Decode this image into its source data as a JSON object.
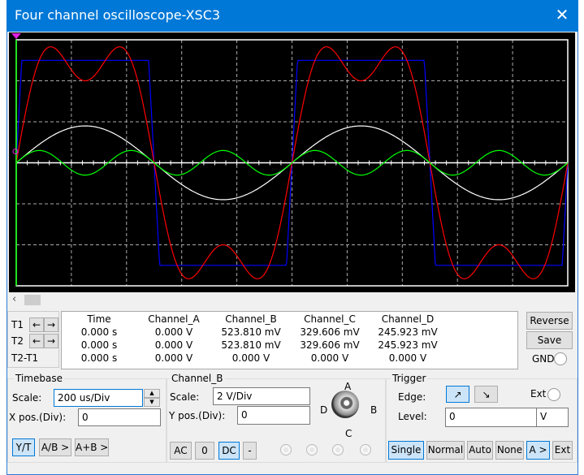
{
  "window": {
    "title": "Four channel oscilloscope-XSC3",
    "close_icon": "close-icon"
  },
  "colors": {
    "titlebar": "#0078d7",
    "channel_A": "#ffffff",
    "channel_B": "#ff0000",
    "channel_C": "#00ff00",
    "channel_D": "#0000ff",
    "screen": "#000000"
  },
  "chart_data": {
    "type": "line",
    "grid": true,
    "divisions": {
      "x": 10,
      "y": 6
    },
    "time_per_div_us": 200,
    "frequency_hz": 1000,
    "series": [
      {
        "channel": "A",
        "color": "#ffffff",
        "shape": "sine",
        "harmonics": [
          1
        ],
        "amplitude_div": 0.9
      },
      {
        "channel": "B",
        "color": "#ff0000",
        "shape": "sum of 1st and 3rd harmonics",
        "harmonics": [
          1,
          3
        ],
        "amplitudes_div": [
          3,
          1
        ]
      },
      {
        "channel": "C",
        "color": "#00ff00",
        "shape": "sine",
        "harmonics": [
          3
        ],
        "amplitude_div": 0.3
      },
      {
        "channel": "D",
        "color": "#0000ff",
        "shape": "square",
        "amplitude_div": 2.5
      }
    ]
  },
  "readout": {
    "row_labels": [
      "T1",
      "T2",
      "T2-T1"
    ],
    "headers": [
      "Time",
      "Channel_A",
      "Channel_B",
      "Channel_C",
      "Channel_D"
    ],
    "rows": [
      [
        "0.000 s",
        "0.000 V",
        "523.810 mV",
        "329.606 mV",
        "245.923 mV"
      ],
      [
        "0.000 s",
        "0.000 V",
        "523.810 mV",
        "329.606 mV",
        "245.923 mV"
      ],
      [
        "0.000 s",
        "0.000 V",
        "0.000 V",
        "0.000 V",
        "0.000 V"
      ]
    ],
    "reverse": "Reverse",
    "save": "Save",
    "gnd": "GND"
  },
  "timebase": {
    "title": "Timebase",
    "scale_label": "Scale:",
    "scale_value": "200 us/Div",
    "xpos_label": "X pos.(Div):",
    "xpos_value": "0",
    "modes": [
      "Y/T",
      "A/B >",
      "A+B >"
    ]
  },
  "channel": {
    "title": "Channel_B",
    "scale_label": "Scale:",
    "scale_value": "2  V/Div",
    "ypos_label": "Y pos.(Div):",
    "ypos_value": "0",
    "knob": {
      "A": "A",
      "B": "B",
      "C": "C",
      "D": "D"
    },
    "coupling": [
      "AC",
      "0",
      "DC",
      "-"
    ]
  },
  "trigger": {
    "title": "Trigger",
    "edge_label": "Edge:",
    "ext_label": "Ext",
    "level_label": "Level:",
    "level_value": "0",
    "level_unit": "V",
    "modes": [
      "Single",
      "Normal",
      "Auto",
      "None",
      "A >",
      "Ext"
    ]
  }
}
